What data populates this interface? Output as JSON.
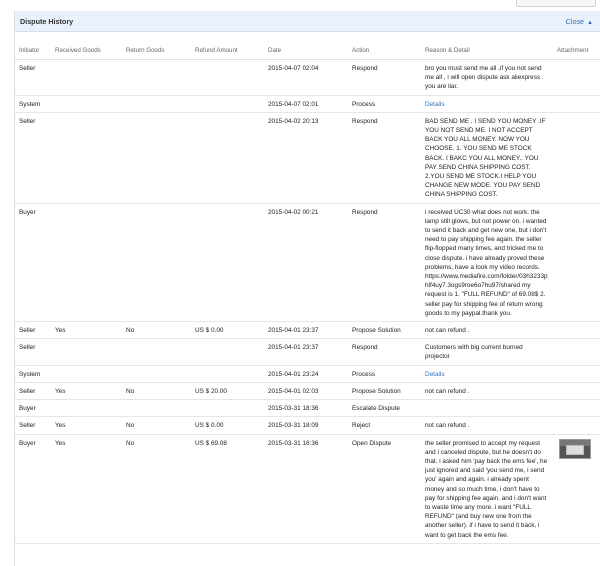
{
  "panel": {
    "title": "Dispute History",
    "close_label": "Close",
    "caret": "▲"
  },
  "columns": {
    "initiator": "Initiator",
    "received_goods": "Received Goods",
    "return_goods": "Return Goods",
    "refund_amount": "Refund Amount",
    "date": "Date",
    "action": "Action",
    "reason": "Reason & Detail",
    "attachment": "Attachment"
  },
  "rows": [
    {
      "initiator": "Seller",
      "received": "",
      "returned": "",
      "amount": "",
      "date": "2015-04-07 02:04",
      "action": "Respond",
      "reason": "bro you must send me all ,if you not send me all , i will open dispute ask aliexpress . you are liar.",
      "is_link": false,
      "attachment": false
    },
    {
      "initiator": "System",
      "received": "",
      "returned": "",
      "amount": "",
      "date": "2015-04-07 02:01",
      "action": "Process",
      "reason": "Details",
      "is_link": true,
      "attachment": false
    },
    {
      "initiator": "Seller",
      "received": "",
      "returned": "",
      "amount": "",
      "date": "2015-04-02 20:13",
      "action": "Respond",
      "reason": "BAD SEND ME . I SEND YOU MONEY .IF YOU NOT SEND ME. I NOT ACCEPT BACK YOU ALL MONEY. NOW YOU CHOOSE. 1. YOU SEND ME STOCK BACK. I BAKC YOU ALL MONEY.. YOU PAY SEND CHINA SHIPPING COST. 2.YOU SEND ME STOCK.I HELP YOU CHANGE NEW MODE. YOU PAY SEND CHINA SHIPPING COST.",
      "is_link": false,
      "attachment": false
    },
    {
      "initiator": "Buyer",
      "received": "",
      "returned": "",
      "amount": "",
      "date": "2015-04-02 00:21",
      "action": "Respond",
      "reason": "i received UC30 what does not work. the lamp still glows, but not power on. i wanted to send it back and get new one, but i don't need to pay shipping fee again. the seller flip-flopped many times, and tricked me to close dispute. i have already proved these problems, have a look my video records. https://www.mediafire.com/folder/03h3233phlf4uy7.3ogs9roe6o7hu97/shared my request is 1. \"FULL REFUND\" of 69.08$ 2. seller pay for shipping fee of return wrong goods to my paypal.thank you.",
      "is_link": false,
      "attachment": false
    },
    {
      "initiator": "Seller",
      "received": "Yes",
      "returned": "No",
      "amount": "US $ 0.00",
      "date": "2015-04-01 23:37",
      "action": "Propose Solution",
      "reason": "not can refund .",
      "is_link": false,
      "attachment": false
    },
    {
      "initiator": "Seller",
      "received": "",
      "returned": "",
      "amount": "",
      "date": "2015-04-01 23:37",
      "action": "Respond",
      "reason": "Customers with big current burned projector",
      "is_link": false,
      "attachment": false
    },
    {
      "initiator": "System",
      "received": "",
      "returned": "",
      "amount": "",
      "date": "2015-04-01 23:24",
      "action": "Process",
      "reason": "Details",
      "is_link": true,
      "attachment": false
    },
    {
      "initiator": "Seller",
      "received": "Yes",
      "returned": "No",
      "amount": "US $ 20.00",
      "date": "2015-04-01 02:03",
      "action": "Propose Solution",
      "reason": "not can refund .",
      "is_link": false,
      "attachment": false
    },
    {
      "initiator": "Buyer",
      "received": "",
      "returned": "",
      "amount": "",
      "date": "2015-03-31 18:36",
      "action": "Escalate Dispute",
      "reason": "",
      "is_link": false,
      "attachment": false
    },
    {
      "initiator": "Seller",
      "received": "Yes",
      "returned": "No",
      "amount": "US $ 0.00",
      "date": "2015-03-31 18:09",
      "action": "Reject",
      "reason": "not can refund .",
      "is_link": false,
      "attachment": false
    },
    {
      "initiator": "Buyer",
      "received": "Yes",
      "returned": "No",
      "amount": "US $ 69.08",
      "date": "2015-03-31 16:36",
      "action": "Open Dispute",
      "reason": "the seller promised to accept my request and i canceled dispute, but he doesn't do that. i asked him 'pay back the ems fee', he just ignored and said 'you send me, i send you' again and again. i already spent money and so much time, i don't have to pay for shipping fee again. and i don't want to waste time any more. i want \"FULL REFUND\" (and buy new one from the another seller). if i have to send it back, i want to get back the ems fee.",
      "is_link": false,
      "attachment": true
    }
  ]
}
